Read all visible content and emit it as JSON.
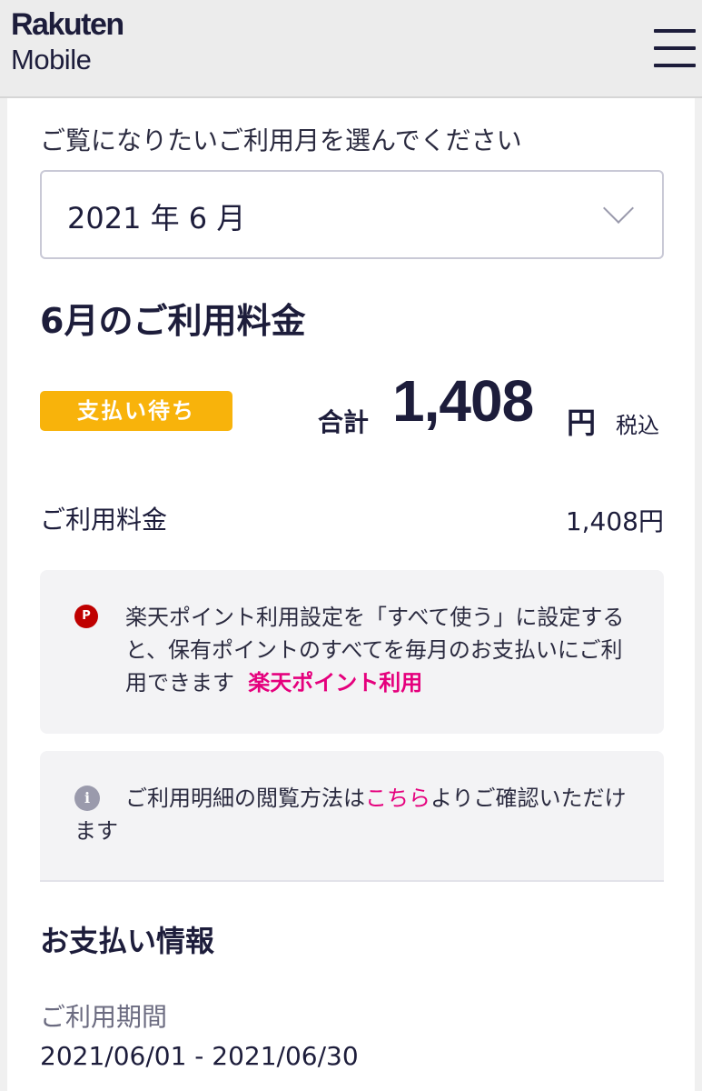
{
  "header": {
    "logo_line1": "Rakuten",
    "logo_line2": "Mobile"
  },
  "month_select": {
    "label": "ご覧になりたいご利用月を選んでください",
    "value": "2021 年 6 月"
  },
  "summary": {
    "title": "6月のご利用料金",
    "status_badge": "支払い待ち",
    "total_label": "合計",
    "total_amount": "1,408",
    "yen": "円",
    "tax_note": "税込"
  },
  "usage_row": {
    "label": "ご利用料金",
    "value": "1,408円"
  },
  "points_notice": {
    "icon_letter": "P",
    "text": "楽天ポイント利用設定を「すべて使う」に設定すると、保有ポイントのすべてを毎月のお支払いにご利用できます",
    "link": "楽天ポイント利用"
  },
  "info_notice": {
    "icon_letter": "i",
    "text_before": "ご利用明細の閲覧方法は",
    "link": "こちら",
    "text_after": "よりご確認いただけます"
  },
  "payment_info": {
    "title": "お支払い情報",
    "period_label": "ご利用期間",
    "period_value": "2021/06/01 - 2021/06/30"
  },
  "colors": {
    "brand_navy": "#1d1d3b",
    "badge_yellow": "#f8b30b",
    "link_pink": "#e5007d",
    "points_red": "#bf0000"
  }
}
